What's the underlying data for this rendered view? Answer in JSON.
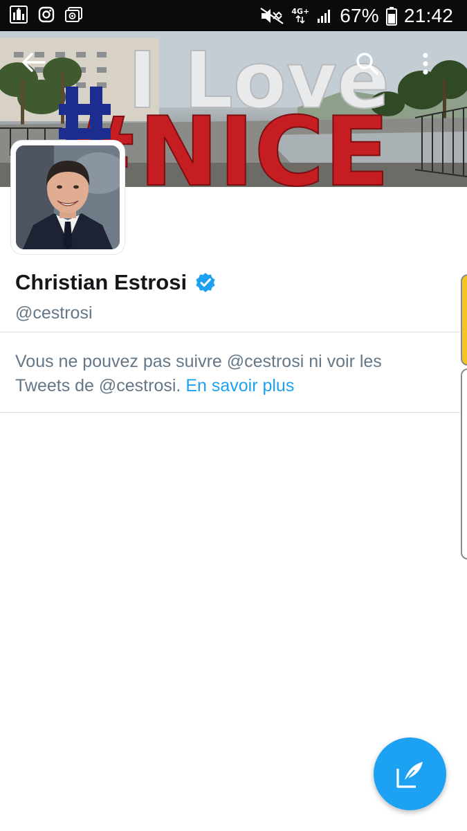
{
  "status_bar": {
    "network": "4G+",
    "battery_percent": "67%",
    "time": "21:42",
    "left_icons": [
      "notification-app-icon",
      "instagram-icon",
      "image-message-icon"
    ],
    "right_icons": [
      "mute-icon",
      "network-4g-icon",
      "signal-icon",
      "battery-icon"
    ]
  },
  "banner": {
    "headline_top": "I Love",
    "headline_bottom": "#NICE"
  },
  "toolbar": {
    "icons": [
      "back-arrow-icon",
      "search-icon",
      "more-vert-icon"
    ]
  },
  "profile": {
    "name": "Christian Estrosi",
    "handle": "@cestrosi",
    "verified": true
  },
  "blocked_notice": {
    "text": "Vous ne pouvez pas suivre @cestrosi ni voir les Tweets de @cestrosi.",
    "link": "En savoir plus"
  },
  "colors": {
    "accent": "#1da1f2",
    "name": "#14171a",
    "secondary_text": "#657786",
    "status_bar": "#0b0b0b"
  },
  "fab": {
    "icon": "compose-tweet-icon"
  }
}
